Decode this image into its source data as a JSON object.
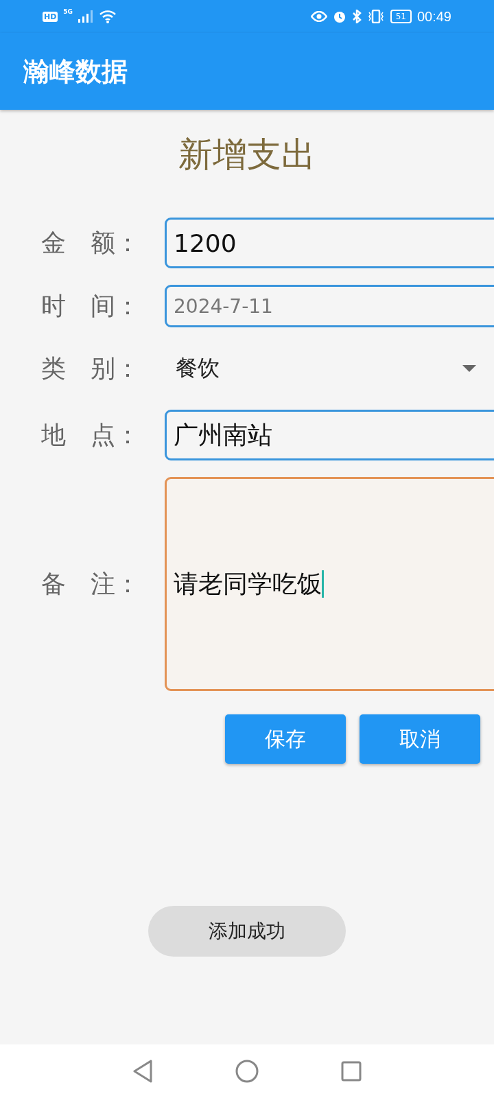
{
  "status_bar": {
    "network": "5G",
    "hd": "HD",
    "battery": "51",
    "time": "00:49"
  },
  "app_bar": {
    "title": "瀚峰数据"
  },
  "form": {
    "title": "新增支出",
    "fields": [
      {
        "kind": "input",
        "label": "金　额：",
        "value": "1200",
        "focused": false
      },
      {
        "kind": "date",
        "label": "时　间：",
        "placeholder": "2024-7-11",
        "focused": false
      },
      {
        "kind": "select",
        "label": "类　别：",
        "value": "餐饮"
      },
      {
        "kind": "input",
        "label": "地　点：",
        "value": "广州南站",
        "focused": false
      },
      {
        "kind": "textarea",
        "label": "备　注：",
        "value": "请老同学吃饭",
        "focused": true
      }
    ],
    "buttons": [
      "保存",
      "取消"
    ]
  },
  "toast": "添加成功"
}
